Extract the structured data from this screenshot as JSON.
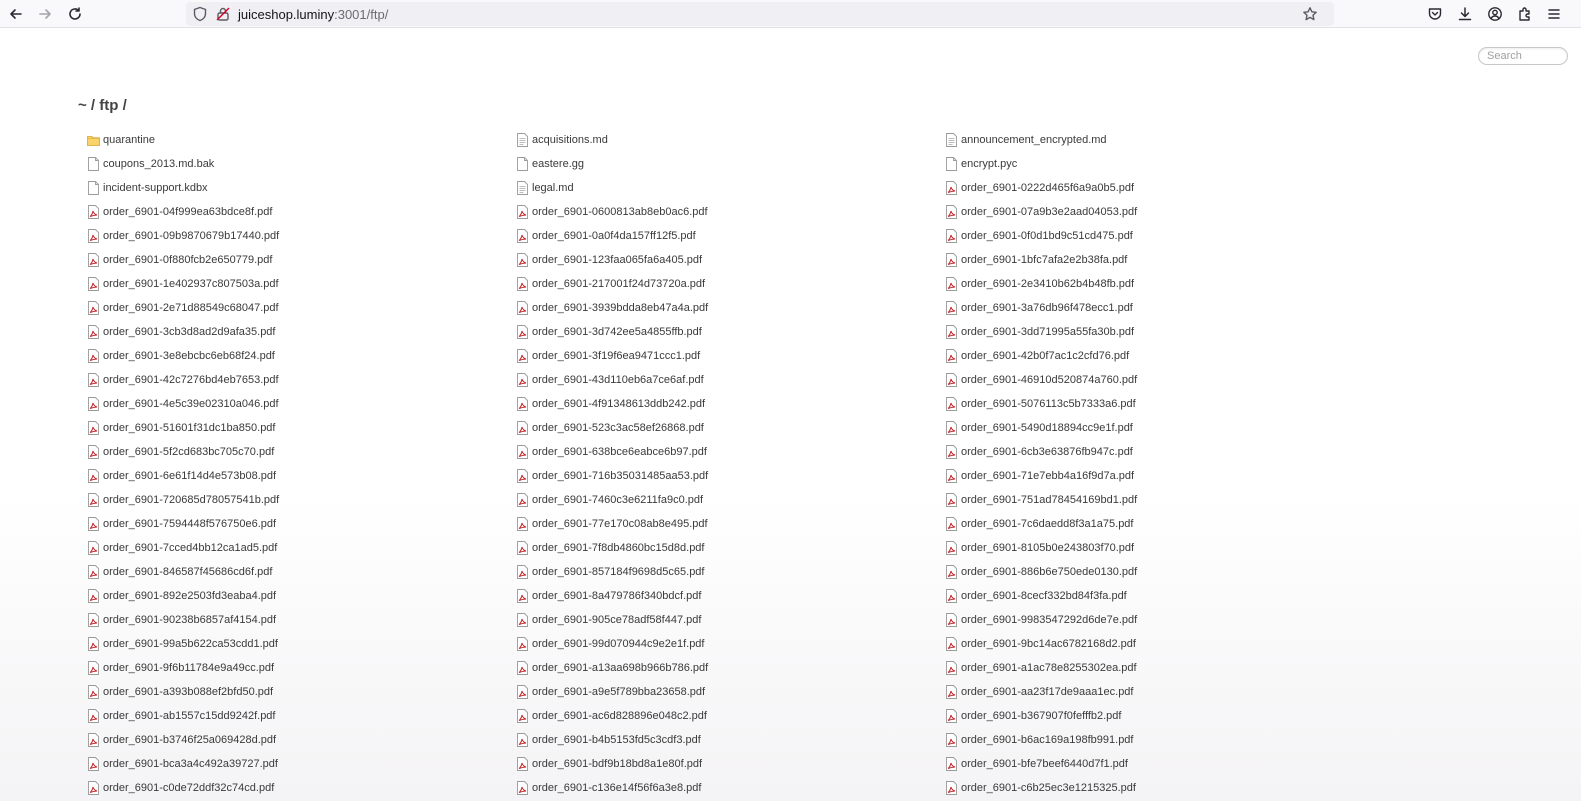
{
  "browser": {
    "url_host": "juiceshop.luminy",
    "url_rest": ":3001/ftp/"
  },
  "page": {
    "search_placeholder": "Search",
    "heading": "~ / ftp /"
  },
  "files": [
    {
      "name": "quarantine",
      "type": "folder"
    },
    {
      "name": "acquisitions.md",
      "type": "text"
    },
    {
      "name": "announcement_encrypted.md",
      "type": "text"
    },
    {
      "name": "coupons_2013.md.bak",
      "type": "file"
    },
    {
      "name": "eastere.gg",
      "type": "file"
    },
    {
      "name": "encrypt.pyc",
      "type": "file"
    },
    {
      "name": "incident-support.kdbx",
      "type": "file"
    },
    {
      "name": "legal.md",
      "type": "text"
    },
    {
      "name": "order_6901-0222d465f6a9a0b5.pdf",
      "type": "pdf"
    },
    {
      "name": "order_6901-04f999ea63bdce8f.pdf",
      "type": "pdf"
    },
    {
      "name": "order_6901-0600813ab8eb0ac6.pdf",
      "type": "pdf"
    },
    {
      "name": "order_6901-07a9b3e2aad04053.pdf",
      "type": "pdf"
    },
    {
      "name": "order_6901-09b9870679b17440.pdf",
      "type": "pdf"
    },
    {
      "name": "order_6901-0a0f4da157ff12f5.pdf",
      "type": "pdf"
    },
    {
      "name": "order_6901-0f0d1bd9c51cd475.pdf",
      "type": "pdf"
    },
    {
      "name": "order_6901-0f880fcb2e650779.pdf",
      "type": "pdf"
    },
    {
      "name": "order_6901-123faa065fa6a405.pdf",
      "type": "pdf"
    },
    {
      "name": "order_6901-1bfc7afa2e2b38fa.pdf",
      "type": "pdf"
    },
    {
      "name": "order_6901-1e402937c807503a.pdf",
      "type": "pdf"
    },
    {
      "name": "order_6901-217001f24d73720a.pdf",
      "type": "pdf"
    },
    {
      "name": "order_6901-2e3410b62b4b48fb.pdf",
      "type": "pdf"
    },
    {
      "name": "order_6901-2e71d88549c68047.pdf",
      "type": "pdf"
    },
    {
      "name": "order_6901-3939bdda8eb47a4a.pdf",
      "type": "pdf"
    },
    {
      "name": "order_6901-3a76db96f478ecc1.pdf",
      "type": "pdf"
    },
    {
      "name": "order_6901-3cb3d8ad2d9afa35.pdf",
      "type": "pdf"
    },
    {
      "name": "order_6901-3d742ee5a4855ffb.pdf",
      "type": "pdf"
    },
    {
      "name": "order_6901-3dd71995a55fa30b.pdf",
      "type": "pdf"
    },
    {
      "name": "order_6901-3e8ebcbc6eb68f24.pdf",
      "type": "pdf"
    },
    {
      "name": "order_6901-3f19f6ea9471ccc1.pdf",
      "type": "pdf"
    },
    {
      "name": "order_6901-42b0f7ac1c2cfd76.pdf",
      "type": "pdf"
    },
    {
      "name": "order_6901-42c7276bd4eb7653.pdf",
      "type": "pdf"
    },
    {
      "name": "order_6901-43d110eb6a7ce6af.pdf",
      "type": "pdf"
    },
    {
      "name": "order_6901-46910d520874a760.pdf",
      "type": "pdf"
    },
    {
      "name": "order_6901-4e5c39e02310a046.pdf",
      "type": "pdf"
    },
    {
      "name": "order_6901-4f91348613ddb242.pdf",
      "type": "pdf"
    },
    {
      "name": "order_6901-5076113c5b7333a6.pdf",
      "type": "pdf"
    },
    {
      "name": "order_6901-51601f31dc1ba850.pdf",
      "type": "pdf"
    },
    {
      "name": "order_6901-523c3ac58ef26868.pdf",
      "type": "pdf"
    },
    {
      "name": "order_6901-5490d18894cc9e1f.pdf",
      "type": "pdf"
    },
    {
      "name": "order_6901-5f2cd683bc705c70.pdf",
      "type": "pdf"
    },
    {
      "name": "order_6901-638bce6eabce6b97.pdf",
      "type": "pdf"
    },
    {
      "name": "order_6901-6cb3e63876fb947c.pdf",
      "type": "pdf"
    },
    {
      "name": "order_6901-6e61f14d4e573b08.pdf",
      "type": "pdf"
    },
    {
      "name": "order_6901-716b35031485aa53.pdf",
      "type": "pdf"
    },
    {
      "name": "order_6901-71e7ebb4a16f9d7a.pdf",
      "type": "pdf"
    },
    {
      "name": "order_6901-720685d78057541b.pdf",
      "type": "pdf"
    },
    {
      "name": "order_6901-7460c3e6211fa9c0.pdf",
      "type": "pdf"
    },
    {
      "name": "order_6901-751ad78454169bd1.pdf",
      "type": "pdf"
    },
    {
      "name": "order_6901-7594448f576750e6.pdf",
      "type": "pdf"
    },
    {
      "name": "order_6901-77e170c08ab8e495.pdf",
      "type": "pdf"
    },
    {
      "name": "order_6901-7c6daedd8f3a1a75.pdf",
      "type": "pdf"
    },
    {
      "name": "order_6901-7cced4bb12ca1ad5.pdf",
      "type": "pdf"
    },
    {
      "name": "order_6901-7f8db4860bc15d8d.pdf",
      "type": "pdf"
    },
    {
      "name": "order_6901-8105b0e243803f70.pdf",
      "type": "pdf"
    },
    {
      "name": "order_6901-846587f45686cd6f.pdf",
      "type": "pdf"
    },
    {
      "name": "order_6901-857184f9698d5c65.pdf",
      "type": "pdf"
    },
    {
      "name": "order_6901-886b6e750ede0130.pdf",
      "type": "pdf"
    },
    {
      "name": "order_6901-892e2503fd3eaba4.pdf",
      "type": "pdf"
    },
    {
      "name": "order_6901-8a479786f340bdcf.pdf",
      "type": "pdf"
    },
    {
      "name": "order_6901-8cecf332bd84f3fa.pdf",
      "type": "pdf"
    },
    {
      "name": "order_6901-90238b6857af4154.pdf",
      "type": "pdf"
    },
    {
      "name": "order_6901-905ce78adf58f447.pdf",
      "type": "pdf"
    },
    {
      "name": "order_6901-9983547292d6de7e.pdf",
      "type": "pdf"
    },
    {
      "name": "order_6901-99a5b622ca53cdd1.pdf",
      "type": "pdf"
    },
    {
      "name": "order_6901-99d070944c9e2e1f.pdf",
      "type": "pdf"
    },
    {
      "name": "order_6901-9bc14ac6782168d2.pdf",
      "type": "pdf"
    },
    {
      "name": "order_6901-9f6b11784e9a49cc.pdf",
      "type": "pdf"
    },
    {
      "name": "order_6901-a13aa698b966b786.pdf",
      "type": "pdf"
    },
    {
      "name": "order_6901-a1ac78e8255302ea.pdf",
      "type": "pdf"
    },
    {
      "name": "order_6901-a393b088ef2bfd50.pdf",
      "type": "pdf"
    },
    {
      "name": "order_6901-a9e5f789bba23658.pdf",
      "type": "pdf"
    },
    {
      "name": "order_6901-aa23f17de9aaa1ec.pdf",
      "type": "pdf"
    },
    {
      "name": "order_6901-ab1557c15dd9242f.pdf",
      "type": "pdf"
    },
    {
      "name": "order_6901-ac6d828896e048c2.pdf",
      "type": "pdf"
    },
    {
      "name": "order_6901-b367907f0fefffb2.pdf",
      "type": "pdf"
    },
    {
      "name": "order_6901-b3746f25a069428d.pdf",
      "type": "pdf"
    },
    {
      "name": "order_6901-b4b5153fd5c3cdf3.pdf",
      "type": "pdf"
    },
    {
      "name": "order_6901-b6ac169a198fb991.pdf",
      "type": "pdf"
    },
    {
      "name": "order_6901-bca3a4c492a39727.pdf",
      "type": "pdf"
    },
    {
      "name": "order_6901-bdf9b18bd8a1e80f.pdf",
      "type": "pdf"
    },
    {
      "name": "order_6901-bfe7beef6440d7f1.pdf",
      "type": "pdf"
    },
    {
      "name": "order_6901-c0de72ddf32c74cd.pdf",
      "type": "pdf"
    },
    {
      "name": "order_6901-c136e14f56f6a3e8.pdf",
      "type": "pdf"
    },
    {
      "name": "order_6901-c6b25ec3e1215325.pdf",
      "type": "pdf"
    }
  ]
}
